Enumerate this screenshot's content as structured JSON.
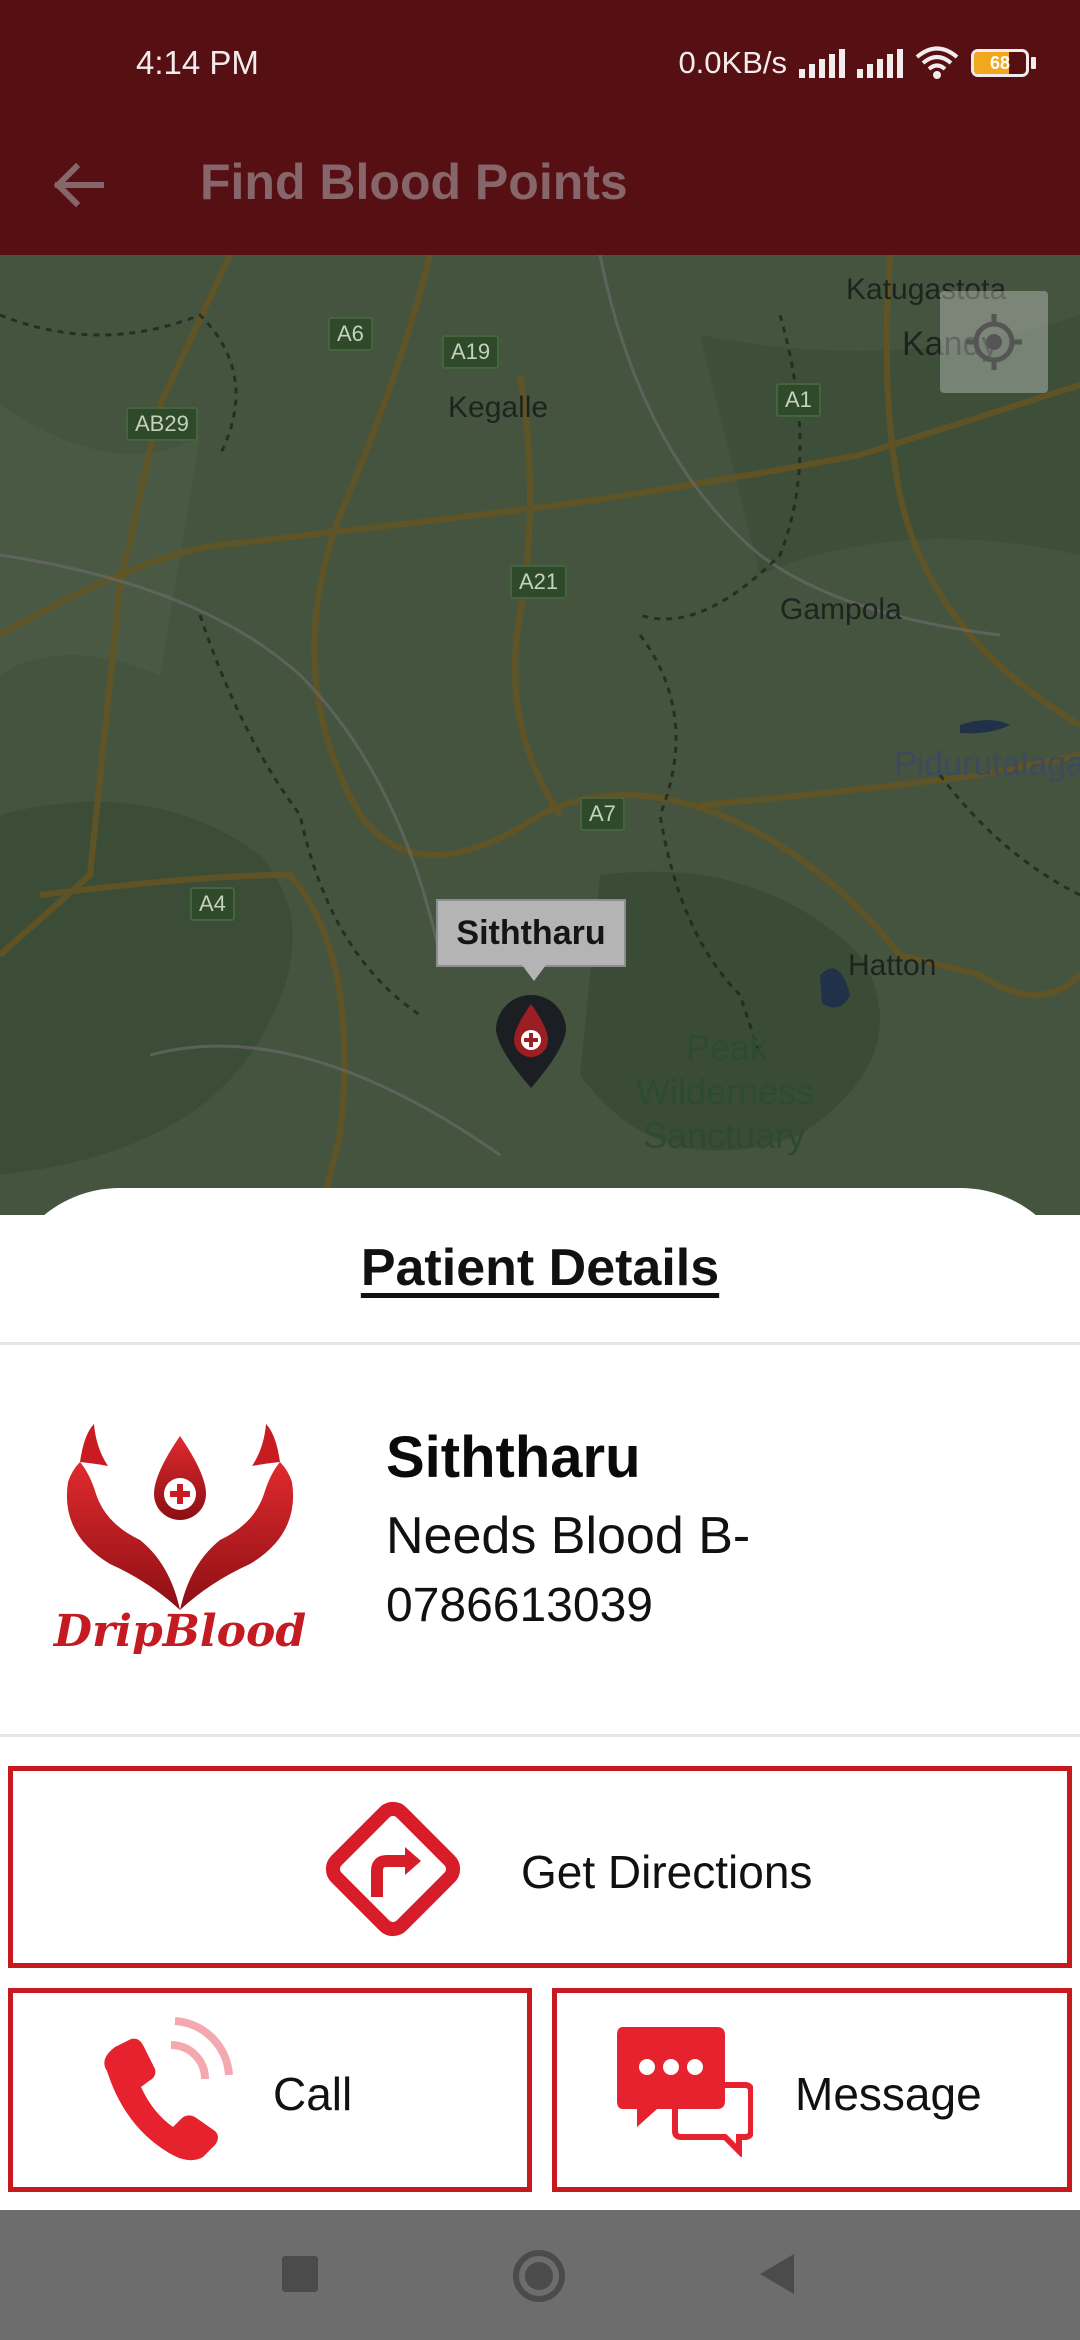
{
  "status_bar": {
    "time": "4:14 PM",
    "net_speed": "0.0KB/s",
    "battery_level": "68",
    "icons": [
      "signal-icon",
      "signal-icon",
      "wifi-icon",
      "battery-icon"
    ]
  },
  "app_bar": {
    "title": "Find Blood Points",
    "back_icon": "arrow-left-icon"
  },
  "map": {
    "places": [
      "Katugastota",
      "Kandy",
      "Kegalle",
      "Gampola",
      "Pidurutalagala",
      "Hatton",
      "Peak",
      "Wilderness",
      "Sanctuary"
    ],
    "routes": [
      "A6",
      "A19",
      "A1",
      "AB29",
      "A21",
      "A7",
      "A4"
    ],
    "marker_label": "Siththaru",
    "locate_icon": "my-location-icon"
  },
  "sheet": {
    "title": "Patient Details",
    "logo_text": "DripBlood",
    "patient_name": "Siththaru",
    "blood_need": "Needs Blood B-",
    "phone": "0786613039"
  },
  "actions": {
    "directions_label": "Get Directions",
    "call_label": "Call",
    "message_label": "Message"
  },
  "colors": {
    "primary_dark": "#560f12",
    "accent_red": "#c71920"
  }
}
